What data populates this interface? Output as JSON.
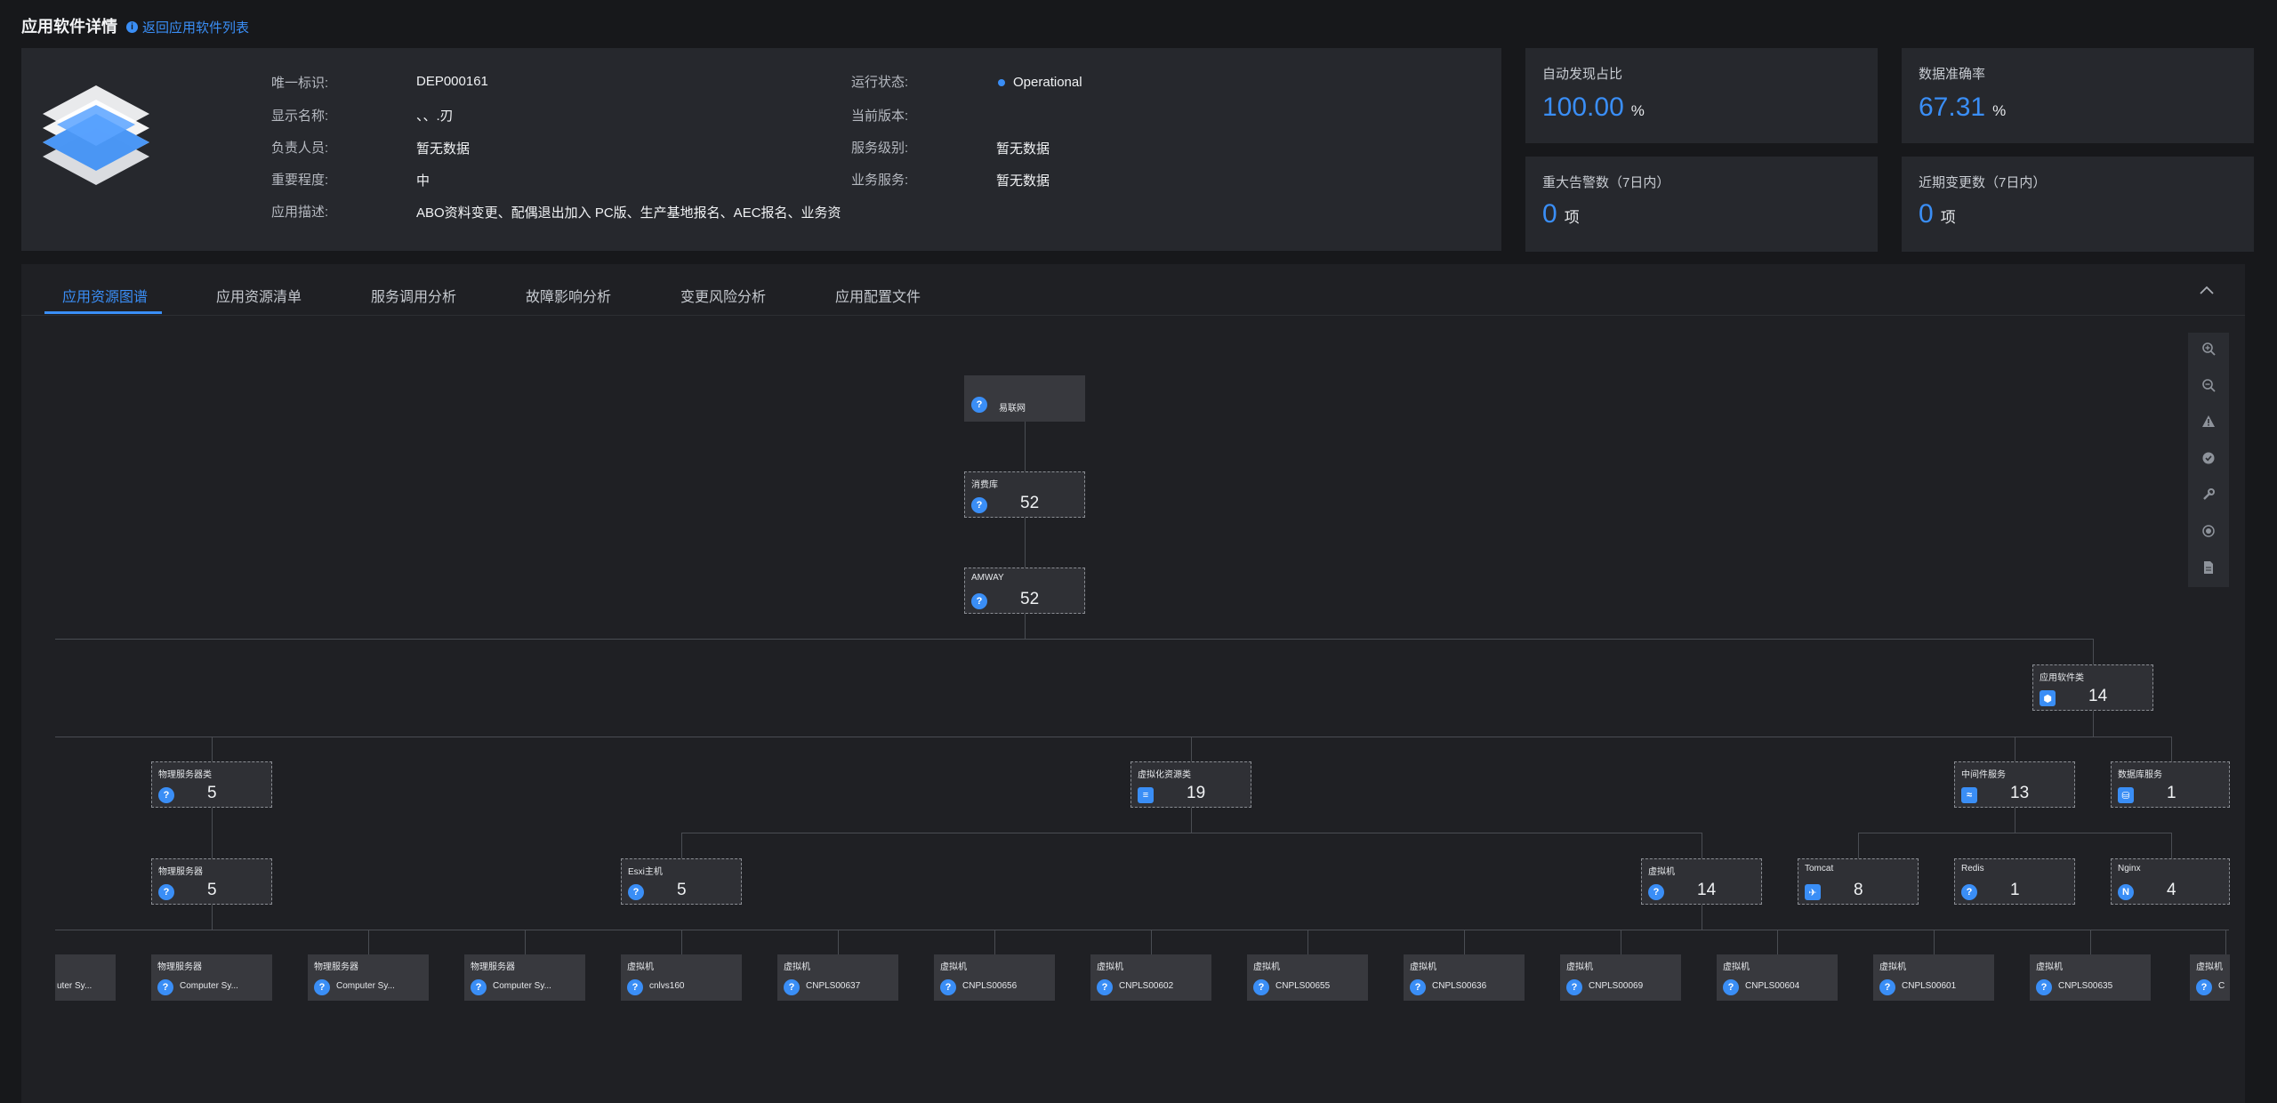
{
  "header": {
    "title": "应用软件详情",
    "back_link": "返回应用软件列表"
  },
  "info": {
    "unique_id_label": "唯一标识:",
    "unique_id_value": "DEP000161",
    "display_name_label": "显示名称:",
    "display_name_value": "、、.刃",
    "owner_label": "负责人员:",
    "owner_value": "暂无数据",
    "importance_label": "重要程度:",
    "importance_value": "中",
    "description_label": "应用描述:",
    "description_value": "ABO资料变更、配偶退出加入 PC版、生产基地报名、AEC报名、业务资",
    "run_status_label": "运行状态:",
    "run_status_value": "Operational",
    "version_label": "当前版本:",
    "version_value": "",
    "service_level_label": "服务级别:",
    "service_level_value": "暂无数据",
    "business_service_label": "业务服务:",
    "business_service_value": "暂无数据"
  },
  "stats": {
    "auto_discovery": {
      "label": "自动发现占比",
      "value": "100.00",
      "unit": "%"
    },
    "accuracy": {
      "label": "数据准确率",
      "value": "67.31",
      "unit": "%"
    },
    "major_alerts": {
      "label": "重大告警数（7日内）",
      "value": "0",
      "unit": "项"
    },
    "recent_changes": {
      "label": "近期变更数（7日内）",
      "value": "0",
      "unit": "项"
    }
  },
  "tabs": [
    "应用资源图谱",
    "应用资源清单",
    "服务调用分析",
    "故障影响分析",
    "变更风险分析",
    "应用配置文件"
  ],
  "toolbar": [
    "zoom-in-icon",
    "zoom-out-icon",
    "alert-icon",
    "check-icon",
    "wrench-icon",
    "record-icon",
    "document-icon"
  ],
  "graph": {
    "root": {
      "text": "易联网"
    },
    "consumer": {
      "label": "消费库",
      "count": "52"
    },
    "amway": {
      "label": "AMWAY",
      "count": "52"
    },
    "app_software": {
      "label": "应用软件类",
      "count": "14"
    },
    "physical_class": {
      "label": "物理服务器类",
      "count": "5"
    },
    "virtual_class": {
      "label": "虚拟化资源类",
      "count": "19"
    },
    "middleware": {
      "label": "中间件服务",
      "count": "13"
    },
    "database": {
      "label": "数据库服务",
      "count": "1"
    },
    "physical_server": {
      "label": "物理服务器",
      "count": "5"
    },
    "esxi": {
      "label": "Esxi主机",
      "count": "5"
    },
    "vm": {
      "label": "虚拟机",
      "count": "14"
    },
    "tomcat": {
      "label": "Tomcat",
      "count": "8"
    },
    "redis": {
      "label": "Redis",
      "count": "1"
    },
    "nginx": {
      "label": "Nginx",
      "count": "4"
    },
    "leaves": [
      {
        "label": "",
        "text": "uter Sy..."
      },
      {
        "label": "物理服务器",
        "text": "Computer Sy..."
      },
      {
        "label": "物理服务器",
        "text": "Computer Sy..."
      },
      {
        "label": "物理服务器",
        "text": "Computer Sy..."
      },
      {
        "label": "虚拟机",
        "text": "cnlvs160"
      },
      {
        "label": "虚拟机",
        "text": "CNPLS00637"
      },
      {
        "label": "虚拟机",
        "text": "CNPLS00656"
      },
      {
        "label": "虚拟机",
        "text": "CNPLS00602"
      },
      {
        "label": "虚拟机",
        "text": "CNPLS00655"
      },
      {
        "label": "虚拟机",
        "text": "CNPLS00636"
      },
      {
        "label": "虚拟机",
        "text": "CNPLS00069"
      },
      {
        "label": "虚拟机",
        "text": "CNPLS00604"
      },
      {
        "label": "虚拟机",
        "text": "CNPLS00601"
      },
      {
        "label": "虚拟机",
        "text": "CNPLS00635"
      },
      {
        "label": "虚拟机",
        "text": "C"
      }
    ]
  }
}
